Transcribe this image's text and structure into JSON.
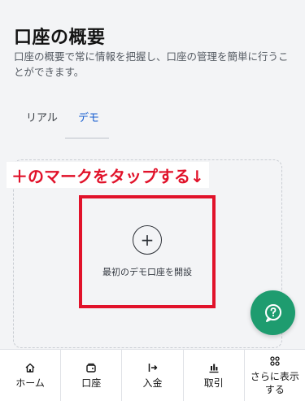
{
  "header": {
    "title": "口座の概要",
    "description": "口座の概要で常に情報を把握し、口座の管理を簡単に行うことができます。"
  },
  "tabs": [
    {
      "label": "リアル",
      "active": false
    },
    {
      "label": "デモ",
      "active": true
    }
  ],
  "card": {
    "annotation": "＋のマークをタップする↓",
    "add_icon": "+",
    "open_demo_label": "最初のデモ口座を開設"
  },
  "colors": {
    "accent_blue": "#1a5fd0",
    "annotation_red": "#e1122a",
    "help_green": "#1e9c6f"
  },
  "bottom_nav": [
    {
      "icon": "home-icon",
      "label": "ホーム"
    },
    {
      "icon": "wallet-icon",
      "label": "口座"
    },
    {
      "icon": "deposit-icon",
      "label": "入金"
    },
    {
      "icon": "trade-icon",
      "label": "取引"
    },
    {
      "icon": "grid-icon",
      "label": "さらに表示する"
    }
  ]
}
